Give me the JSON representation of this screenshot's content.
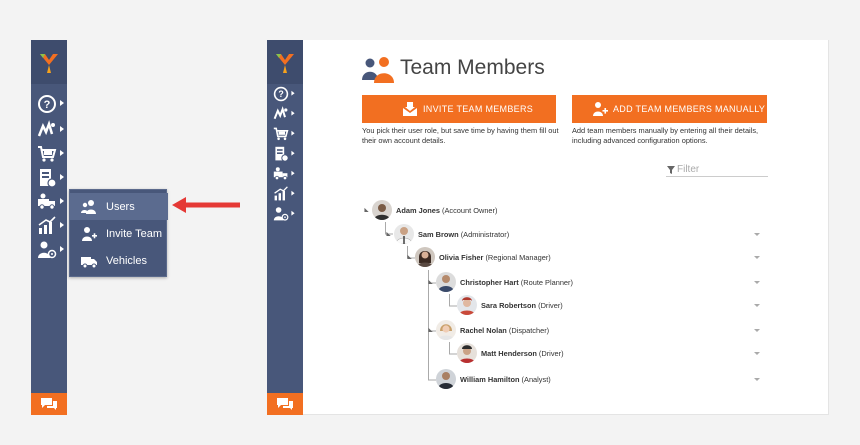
{
  "sidebar": {
    "help_icon": "help-circle-icon",
    "icons": [
      "help-circle-icon",
      "routes-icon",
      "cart-icon",
      "orders-icon",
      "team-icon",
      "analytics-icon",
      "settings-user-icon",
      "chat-icon"
    ]
  },
  "flyout": {
    "items": [
      {
        "label": "Users",
        "icon": "users-icon"
      },
      {
        "label": "Invite Team",
        "icon": "invite-team-icon"
      },
      {
        "label": "Vehicles",
        "icon": "vehicle-icon"
      }
    ]
  },
  "page": {
    "title": "Team Members"
  },
  "actions": {
    "invite_label": "INVITE TEAM MEMBERS",
    "invite_desc": "You pick their user role, but save time by having them fill out their own account details.",
    "manual_label": "ADD TEAM MEMBERS MANUALLY",
    "manual_desc": "Add team members manually by entering all their details, including advanced configuration options."
  },
  "filter": {
    "placeholder": "Filter"
  },
  "tree": [
    {
      "name": "Adam Jones",
      "role": "(Account Owner)"
    },
    {
      "name": "Sam Brown",
      "role": "(Administrator)"
    },
    {
      "name": "Olivia Fisher",
      "role": "(Regional Manager)"
    },
    {
      "name": "Christopher Hart",
      "role": "(Route Planner)"
    },
    {
      "name": "Sara Robertson",
      "role": "(Driver)"
    },
    {
      "name": "Rachel Nolan",
      "role": "(Dispatcher)"
    },
    {
      "name": "Matt Henderson",
      "role": "(Driver)"
    },
    {
      "name": "William Hamilton",
      "role": "(Analyst)"
    }
  ],
  "colors": {
    "sidebar": "#48577a",
    "accent": "#f26f21",
    "arrow": "#e53935"
  }
}
